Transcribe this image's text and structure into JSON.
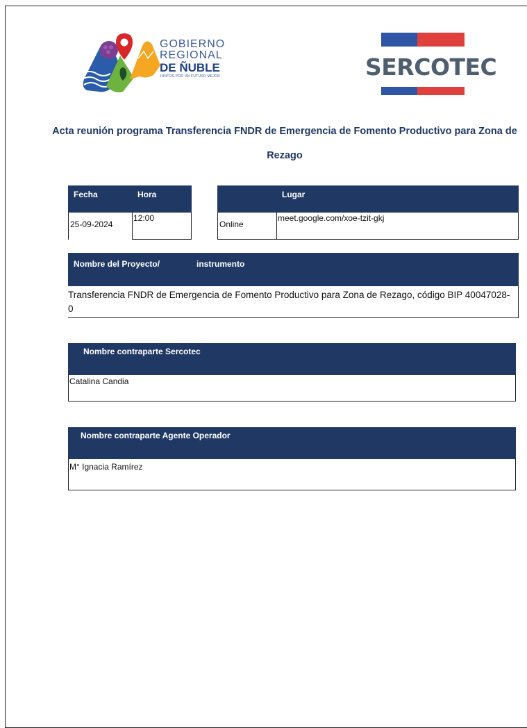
{
  "logos": {
    "gobierno": {
      "line1": "GOBIERNO",
      "line2": "REGIONAL",
      "line3": "DE ÑUBLE",
      "tagline": "JUNTOS POR UN FUTURO MEJOR"
    },
    "sercotec": {
      "word": "SERCOTEC"
    }
  },
  "title": "Acta reunión programa Transferencia FNDR de Emergencia de Fomento Productivo para Zona de Rezago",
  "table1": {
    "fecha_label": "Fecha",
    "hora_label": "Hora",
    "lugar_label": "Lugar",
    "fecha_value": "25-09-2024",
    "hora_value": "12:00",
    "modalidad_value": "Online",
    "lugar_value": "meet.google.com/xoe-tzit-gkj"
  },
  "table2": {
    "label_part1": "Nombre del Proyecto/",
    "label_part2": "instrumento",
    "value": "Transferencia FNDR de Emergencia de Fomento Productivo para Zona de Rezago, código BIP 40047028-0"
  },
  "table3": {
    "label": "Nombre contraparte Sercotec",
    "value": "Catalina Candia"
  },
  "table4": {
    "label": "Nombre contraparte Agente Operador",
    "value": "M° Ignacia Ramírez"
  },
  "colors": {
    "header_navy": "#1f3864",
    "sercotec_red": "#e0403c",
    "sercotec_blue": "#2f55a4"
  }
}
